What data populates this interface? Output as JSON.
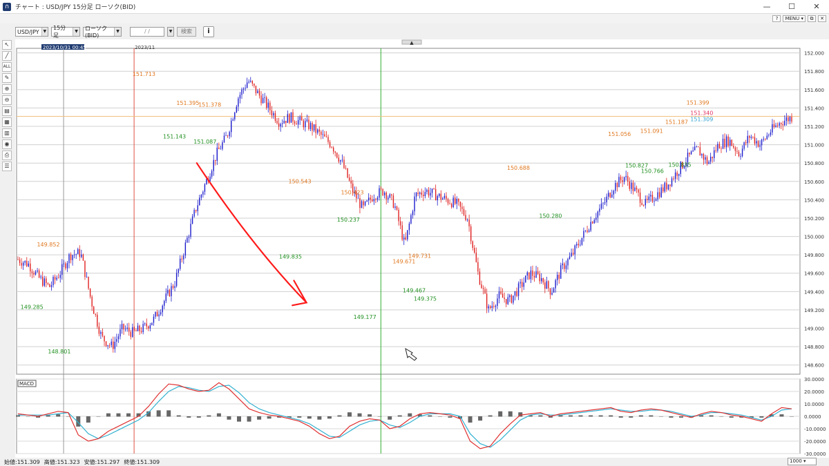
{
  "window": {
    "title": "チャート : USD/JPY 15分足 ローソク(BID)",
    "minimize": "—",
    "maximize": "☐",
    "close": "✕"
  },
  "subbar": {
    "help": "?",
    "menu": "MENU ▾"
  },
  "toolbar": {
    "pair": "USD/JPY",
    "timeframe": "15分足",
    "chart_type": "ローソク(BID)",
    "date_placeholder": "/ /",
    "search": "検索",
    "info": "i"
  },
  "tools": [
    {
      "name": "cursor-icon",
      "glyph": "↖"
    },
    {
      "name": "trendline-icon",
      "glyph": "╱"
    },
    {
      "name": "all-icon",
      "glyph": "ALL"
    },
    {
      "name": "edit-icon",
      "glyph": "✎"
    },
    {
      "name": "zoom-in-icon",
      "glyph": "⊕"
    },
    {
      "name": "zoom-out-icon",
      "glyph": "⊖"
    },
    {
      "name": "indicator-icon",
      "glyph": "▤"
    },
    {
      "name": "tech-icon",
      "glyph": "▦"
    },
    {
      "name": "grid-icon",
      "glyph": "▥"
    },
    {
      "name": "eye-icon",
      "glyph": "◉"
    },
    {
      "name": "print-icon",
      "glyph": "⎙"
    },
    {
      "name": "settings-icon",
      "glyph": "☰"
    }
  ],
  "crosshair_labels": {
    "date_time": "2023/10/31 00:45",
    "month": "2023/11"
  },
  "chart_data": [
    {
      "type": "candlestick",
      "pair": "USD/JPY",
      "ylim": [
        148.5,
        152.05
      ],
      "y_ticks": [
        "152.000",
        "151.800",
        "151.600",
        "151.400",
        "151.200",
        "151.000",
        "150.800",
        "150.600",
        "150.400",
        "150.200",
        "150.000",
        "149.800",
        "149.600",
        "149.400",
        "149.200",
        "149.000",
        "148.800",
        "148.600"
      ],
      "price_path": [
        149.75,
        149.7,
        149.55,
        149.45,
        149.6,
        149.8,
        149.82,
        149.3,
        148.9,
        148.8,
        149.0,
        148.95,
        149.0,
        149.1,
        149.3,
        149.5,
        149.9,
        150.3,
        150.6,
        150.9,
        151.1,
        151.5,
        151.7,
        151.55,
        151.4,
        151.25,
        151.3,
        151.25,
        151.2,
        151.1,
        151.0,
        150.8,
        150.5,
        150.3,
        150.45,
        150.5,
        150.35,
        149.9,
        150.45,
        150.5,
        150.45,
        150.4,
        150.35,
        150.2,
        149.6,
        149.2,
        149.35,
        149.3,
        149.45,
        149.6,
        149.55,
        149.4,
        149.65,
        149.8,
        150.0,
        150.2,
        150.35,
        150.55,
        150.65,
        150.5,
        150.35,
        150.45,
        150.55,
        150.7,
        150.85,
        150.95,
        150.8,
        151.0,
        151.05,
        150.9,
        151.1,
        151.0,
        151.15,
        151.25,
        151.3
      ],
      "labels_high": [
        {
          "text": "149.852",
          "x": 0.026,
          "y": 149.852
        },
        {
          "text": "151.713",
          "x": 0.148,
          "y": 151.713
        },
        {
          "text": "151.395",
          "x": 0.204,
          "y": 151.395
        },
        {
          "text": "151.378",
          "x": 0.232,
          "y": 151.378
        },
        {
          "text": "150.543",
          "x": 0.347,
          "y": 150.543
        },
        {
          "text": "150.423",
          "x": 0.414,
          "y": 150.423
        },
        {
          "text": "149.671",
          "x": 0.48,
          "y": 149.671
        },
        {
          "text": "149.731",
          "x": 0.5,
          "y": 149.731
        },
        {
          "text": "150.688",
          "x": 0.626,
          "y": 150.688
        },
        {
          "text": "151.056",
          "x": 0.755,
          "y": 151.056
        },
        {
          "text": "151.091",
          "x": 0.796,
          "y": 151.091
        },
        {
          "text": "151.187",
          "x": 0.828,
          "y": 151.187
        },
        {
          "text": "151.399",
          "x": 0.855,
          "y": 151.399
        }
      ],
      "labels_low": [
        {
          "text": "149.285",
          "x": 0.005,
          "y": 149.285
        },
        {
          "text": "148.801",
          "x": 0.04,
          "y": 148.801
        },
        {
          "text": "151.143",
          "x": 0.187,
          "y": 151.143
        },
        {
          "text": "151.087",
          "x": 0.226,
          "y": 151.087
        },
        {
          "text": "149.835",
          "x": 0.335,
          "y": 149.835
        },
        {
          "text": "150.237",
          "x": 0.409,
          "y": 150.237
        },
        {
          "text": "149.177",
          "x": 0.43,
          "y": 149.177
        },
        {
          "text": "149.467",
          "x": 0.493,
          "y": 149.467
        },
        {
          "text": "149.375",
          "x": 0.507,
          "y": 149.375
        },
        {
          "text": "150.280",
          "x": 0.667,
          "y": 150.28
        },
        {
          "text": "150.827",
          "x": 0.777,
          "y": 150.827
        },
        {
          "text": "150.766",
          "x": 0.797,
          "y": 150.766
        },
        {
          "text": "150.835",
          "x": 0.832,
          "y": 150.835
        }
      ],
      "current": {
        "ask": "151.340",
        "bid": "151.309",
        "level": 151.309
      },
      "colors": {
        "up": "#1a1acc",
        "down": "#e02020",
        "high_label": "#e07820",
        "low_label": "#209020",
        "bid_line": "#f0c080",
        "cursor_line": "#30b030",
        "date_line": "#e05040",
        "annotation": "#ff1a1a"
      }
    },
    {
      "type": "line",
      "name": "MACD",
      "ylim": [
        -30,
        30
      ],
      "y_ticks": [
        "30.0000",
        "20.0000",
        "10.0000",
        "0.0000",
        "-10.0000",
        "-20.0000",
        "-30.0000"
      ],
      "macd": [
        2,
        1,
        0,
        2,
        4,
        3,
        -15,
        -20,
        -18,
        -12,
        -8,
        -4,
        0,
        8,
        18,
        26,
        25,
        22,
        20,
        21,
        27,
        22,
        14,
        6,
        3,
        1,
        0,
        -2,
        -4,
        -8,
        -14,
        -18,
        -16,
        -8,
        -4,
        -2,
        -3,
        -10,
        -8,
        -2,
        2,
        3,
        2,
        1,
        -2,
        -20,
        -26,
        -24,
        -14,
        -6,
        1,
        2,
        3,
        0,
        2,
        3,
        4,
        5,
        6,
        7,
        4,
        3,
        5,
        6,
        5,
        3,
        1,
        -1,
        2,
        4,
        3,
        1,
        0,
        -2,
        -4,
        2,
        7,
        6
      ],
      "signal": [
        1,
        1,
        1,
        1,
        2,
        3,
        -5,
        -14,
        -18,
        -15,
        -11,
        -7,
        -3,
        3,
        12,
        20,
        24,
        23,
        21,
        20,
        24,
        25,
        19,
        11,
        6,
        3,
        1,
        -1,
        -3,
        -6,
        -11,
        -16,
        -17,
        -12,
        -7,
        -4,
        -3,
        -7,
        -9,
        -5,
        0,
        2,
        2,
        2,
        0,
        -14,
        -22,
        -25,
        -19,
        -11,
        -3,
        1,
        2,
        1,
        1,
        2,
        3,
        4,
        5,
        6,
        5,
        4,
        4,
        5,
        5,
        4,
        2,
        0,
        1,
        3,
        3,
        2,
        1,
        -1,
        -3,
        0,
        5,
        6
      ],
      "colors": {
        "macd": "#e03030",
        "signal": "#30b0d0",
        "hist": "#666666"
      }
    }
  ],
  "status": {
    "open": "始値:151.309",
    "high": "高値:151.323",
    "low": "安値:151.297",
    "close": "終値:151.309",
    "zoom": "1000"
  }
}
